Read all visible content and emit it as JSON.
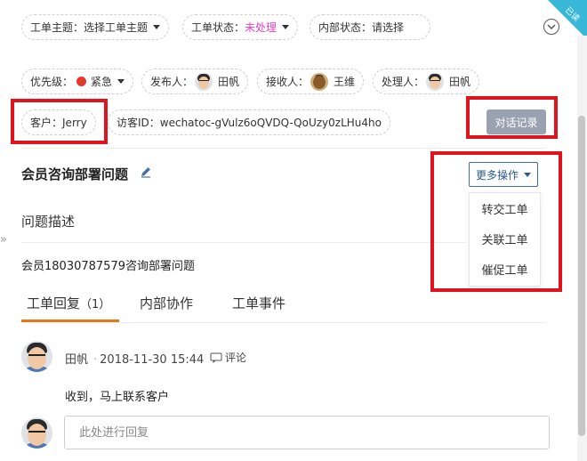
{
  "filters": {
    "topic": {
      "label": "工单主题：",
      "value": "选择工单主题"
    },
    "status": {
      "label": "工单状态：",
      "value": "未处理",
      "value_color": "#e040c8"
    },
    "internal_status": {
      "label": "内部状态：",
      "value": "请选择"
    },
    "priority": {
      "label": "优先级：",
      "value": "紧急",
      "dot_color": "#e23a2a"
    },
    "publisher": {
      "label": "发布人：",
      "name": "田帆"
    },
    "receiver": {
      "label": "接收人：",
      "name": "王维"
    },
    "handler": {
      "label": "处理人：",
      "name": "田帆"
    }
  },
  "customer": {
    "label": "客户：",
    "name": "Jerry"
  },
  "visitor": {
    "label": "访客ID：",
    "value": "wechatoc-gVulz6oQVDQ-QoUzy0zLHu4ho"
  },
  "record_button": "对话记录",
  "corner_badge": "已读",
  "ticket": {
    "title": "会员咨询部署问题",
    "more_ops": "更多操作",
    "menu": [
      "转交工单",
      "关联工单",
      "催促工单"
    ],
    "section_label": "问题描述",
    "description": "会员18030787579咨询部署问题"
  },
  "tabs": [
    {
      "label": "工单回复",
      "count": "（1）"
    },
    {
      "label": "内部协作"
    },
    {
      "label": "工单事件"
    }
  ],
  "reply": {
    "author": "田帆",
    "datetime": "2018-11-30 15:44",
    "comment_label": "评论",
    "text": "收到，马上联系客户",
    "input_placeholder": "此处进行回复"
  },
  "colors": {
    "highlight_box": "#e0141e",
    "accent_tab": "#e27a1a",
    "record_button_bg": "#9aa1b0"
  }
}
